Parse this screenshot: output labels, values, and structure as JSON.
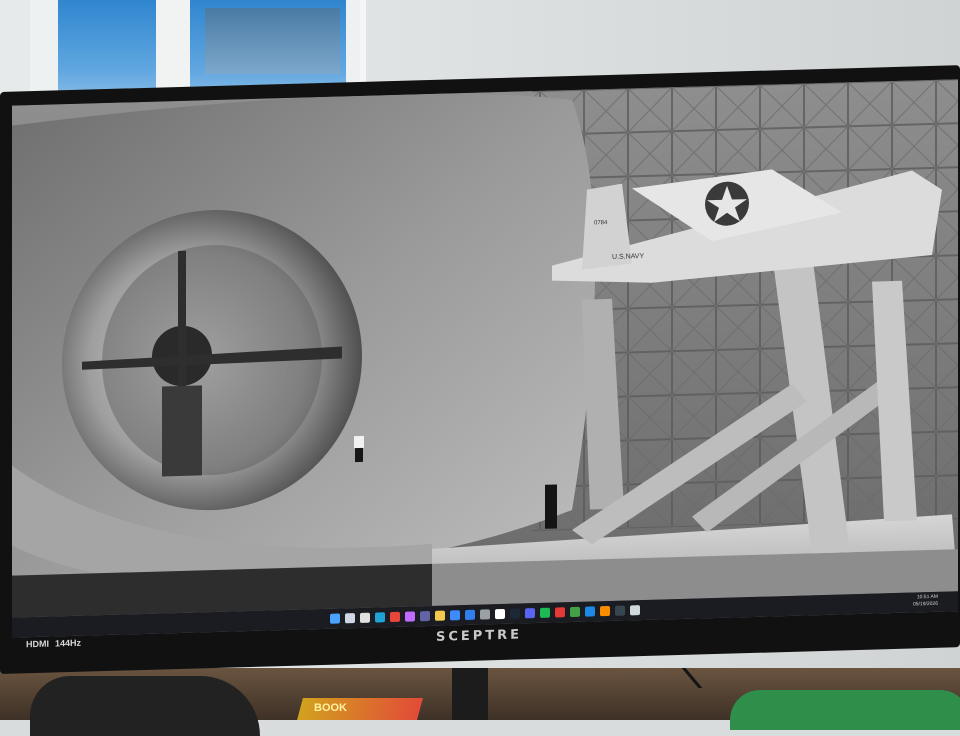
{
  "monitor": {
    "brand": "SCEPTRE",
    "badges": [
      "HDMI",
      "144Hz"
    ]
  },
  "wallpaper": {
    "aircraft_marking": "U.S.NAVY",
    "tail_number": "0784"
  },
  "taskbar": {
    "icons": [
      {
        "name": "start-icon",
        "color": "#4aa3ff"
      },
      {
        "name": "search-icon",
        "color": "#cfd6e4"
      },
      {
        "name": "task-view-icon",
        "color": "#e0e0e0"
      },
      {
        "name": "edge-icon",
        "color": "#1fa2d6"
      },
      {
        "name": "chrome-icon",
        "color": "#e8453c"
      },
      {
        "name": "photos-icon",
        "color": "#c26cff"
      },
      {
        "name": "teams-icon",
        "color": "#6264a7"
      },
      {
        "name": "file-explorer-icon",
        "color": "#f2c94c"
      },
      {
        "name": "store-icon",
        "color": "#3d8bfd"
      },
      {
        "name": "mail-icon",
        "color": "#2f80ed"
      },
      {
        "name": "settings-icon",
        "color": "#9aa0a6"
      },
      {
        "name": "tiktok-icon",
        "color": "#ffffff"
      },
      {
        "name": "steam-icon",
        "color": "#1b2838"
      },
      {
        "name": "discord-icon",
        "color": "#5865f2"
      },
      {
        "name": "spotify-icon",
        "color": "#1db954"
      },
      {
        "name": "app-red-icon",
        "color": "#e53935"
      },
      {
        "name": "app-green-icon",
        "color": "#43a047"
      },
      {
        "name": "app-blue-icon",
        "color": "#1e88e5"
      },
      {
        "name": "app-orange-icon",
        "color": "#fb8c00"
      },
      {
        "name": "app-dark-icon",
        "color": "#37474f"
      },
      {
        "name": "app-light-icon",
        "color": "#cfd8dc"
      }
    ],
    "clock": {
      "time": "10:51 AM",
      "date": "05/19/2026"
    }
  },
  "scene": {
    "book_label": "BOOK"
  }
}
